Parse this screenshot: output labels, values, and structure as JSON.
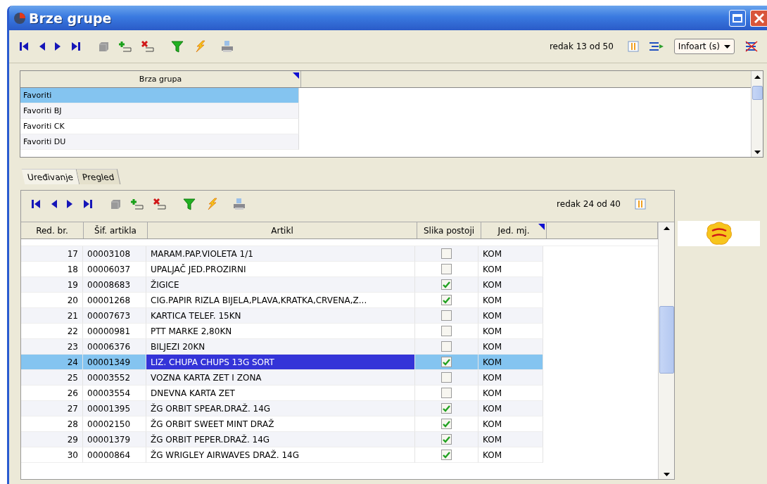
{
  "window": {
    "title": "Brze grupe"
  },
  "toolbar": {
    "tools": [
      {
        "kind": "first"
      },
      {
        "kind": "prev"
      },
      {
        "kind": "next"
      },
      {
        "kind": "last"
      },
      {
        "kind": "copy"
      },
      {
        "kind": "add"
      },
      {
        "kind": "delete"
      },
      {
        "kind": "filter"
      },
      {
        "kind": "lightning"
      },
      {
        "kind": "print"
      }
    ],
    "record": "redak 13 od 50",
    "source": "Infoart (s)"
  },
  "groups": {
    "column": "Brza grupa",
    "rows": [
      {
        "name": "Favoriti",
        "selected": true
      },
      {
        "name": "Favoriti BJ",
        "selected": false
      },
      {
        "name": "Favoriti CK",
        "selected": false
      },
      {
        "name": "Favoriti DU",
        "selected": false
      }
    ]
  },
  "tabs": [
    {
      "label": "Uređivanje",
      "selected": true
    },
    {
      "label": "Pregled",
      "selected": false
    }
  ],
  "items": {
    "tools": [
      {
        "kind": "first"
      },
      {
        "kind": "prev"
      },
      {
        "kind": "next"
      },
      {
        "kind": "last"
      },
      {
        "kind": "copy"
      },
      {
        "kind": "add"
      },
      {
        "kind": "delete"
      },
      {
        "kind": "filter"
      },
      {
        "kind": "lightning"
      },
      {
        "kind": "print"
      }
    ],
    "record": "redak 24 od 40",
    "columns": [
      "Red. br.",
      "Šif. artikla",
      "Artikl",
      "Slika postoji",
      "Jed. mj."
    ],
    "rows": [
      {
        "no": "17",
        "code": "00003108",
        "name": "MARAM.PAP.VIOLETA 1/1",
        "image_exists": false,
        "unit": "KOM",
        "selected": false
      },
      {
        "no": "18",
        "code": "00006037",
        "name": "UPALJAČ  JED.PROZIRNI",
        "image_exists": false,
        "unit": "KOM",
        "selected": false
      },
      {
        "no": "19",
        "code": "00008683",
        "name": "ŽIGICE",
        "image_exists": true,
        "unit": "KOM",
        "selected": false
      },
      {
        "no": "20",
        "code": "00001268",
        "name": "CIG.PAPIR RIZLA BIJELA,PLAVA,KRATKA,CRVENA,Z...",
        "image_exists": true,
        "unit": "KOM",
        "selected": false
      },
      {
        "no": "21",
        "code": "00007673",
        "name": "KARTICA TELEF. 15KN",
        "image_exists": false,
        "unit": "KOM",
        "selected": false
      },
      {
        "no": "22",
        "code": "00000981",
        "name": "PTT MARKE 2,80KN",
        "image_exists": false,
        "unit": "KOM",
        "selected": false
      },
      {
        "no": "23",
        "code": "00006376",
        "name": "BILJEZI 20KN",
        "image_exists": false,
        "unit": "KOM",
        "selected": false
      },
      {
        "no": "24",
        "code": "00001349",
        "name": "LIZ. CHUPA CHUPS 13G SORT",
        "image_exists": true,
        "unit": "KOM",
        "selected": true
      },
      {
        "no": "25",
        "code": "00003552",
        "name": "VOZNA KARTA ZET I ZONA",
        "image_exists": false,
        "unit": "KOM",
        "selected": false
      },
      {
        "no": "26",
        "code": "00003554",
        "name": "DNEVNA KARTA ZET",
        "image_exists": false,
        "unit": "KOM",
        "selected": false
      },
      {
        "no": "27",
        "code": "00001395",
        "name": "ŽG ORBIT SPEAR.DRAŽ. 14G",
        "image_exists": true,
        "unit": "KOM",
        "selected": false
      },
      {
        "no": "28",
        "code": "00002150",
        "name": "ŽG ORBIT SWEET MINT DRAŽ",
        "image_exists": true,
        "unit": "KOM",
        "selected": false
      },
      {
        "no": "29",
        "code": "00001379",
        "name": "ŽG ORBIT PEPER.DRAŽ. 14G",
        "image_exists": true,
        "unit": "KOM",
        "selected": false
      },
      {
        "no": "30",
        "code": "00000864",
        "name": "ŽG WRIGLEY AIRWAVES DRAŽ. 14G",
        "image_exists": true,
        "unit": "KOM",
        "selected": false
      }
    ]
  }
}
